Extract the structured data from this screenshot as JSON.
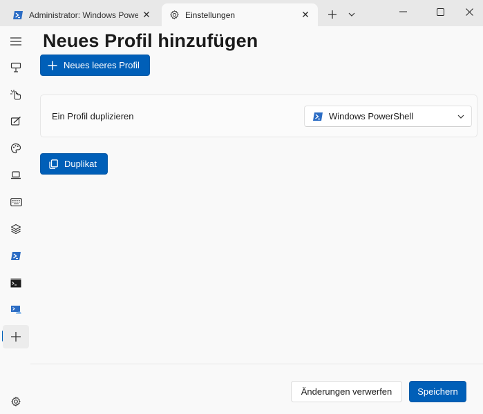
{
  "tabs": [
    {
      "label": "Administrator: Windows Powe",
      "active": false,
      "icon": "powershell-icon"
    },
    {
      "label": "Einstellungen",
      "active": true,
      "icon": "gear-icon"
    }
  ],
  "page": {
    "title": "Neues Profil hinzufügen",
    "new_button": "Neues leeres Profil",
    "duplicate_label": "Ein Profil duplizieren",
    "duplicate_selected": "Windows PowerShell",
    "duplicate_button": "Duplikat"
  },
  "footer": {
    "discard": "Änderungen verwerfen",
    "save": "Speichern"
  },
  "colors": {
    "accent": "#005fb8",
    "powershell": "#2b6cc4"
  }
}
